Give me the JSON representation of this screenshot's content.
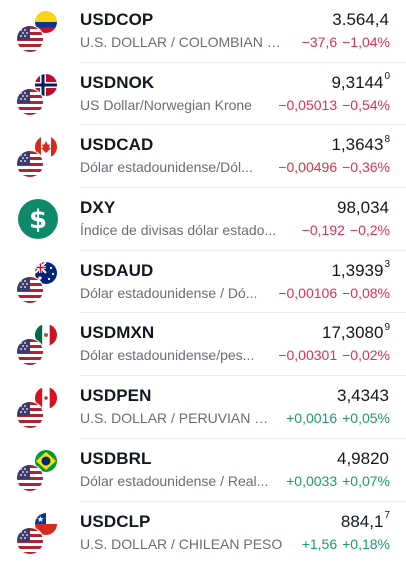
{
  "rows": [
    {
      "symbol": "USDCOP",
      "description": "U.S. DOLLAR / COLOMBIAN P...",
      "price": "3.564,4",
      "price_sup": "",
      "change": "−37,6",
      "change_pct": "−1,04%",
      "direction": "neg",
      "flag": "co"
    },
    {
      "symbol": "USDNOK",
      "description": "US Dollar/Norwegian Krone",
      "price": "9,3144",
      "price_sup": "0",
      "change": "−0,05013",
      "change_pct": "−0,54%",
      "direction": "neg",
      "flag": "no"
    },
    {
      "symbol": "USDCAD",
      "description": "Dólar estadounidense/Dól...",
      "price": "1,3643",
      "price_sup": "8",
      "change": "−0,00496",
      "change_pct": "−0,36%",
      "direction": "neg",
      "flag": "ca"
    },
    {
      "symbol": "DXY",
      "description": "Índice de divisas dólar estado...",
      "price": "98,034",
      "price_sup": "",
      "change": "−0,192",
      "change_pct": "−0,2%",
      "direction": "neg",
      "flag": "dxy"
    },
    {
      "symbol": "USDAUD",
      "description": "Dólar estadounidense / Dó...",
      "price": "1,3939",
      "price_sup": "3",
      "change": "−0,00106",
      "change_pct": "−0,08%",
      "direction": "neg",
      "flag": "au"
    },
    {
      "symbol": "USDMXN",
      "description": "Dólar estadounidense/pes...",
      "price": "17,3080",
      "price_sup": "9",
      "change": "−0,00301",
      "change_pct": "−0,02%",
      "direction": "neg",
      "flag": "mx"
    },
    {
      "symbol": "USDPEN",
      "description": "U.S. DOLLAR / PERUVIAN S...",
      "price": "3,4343",
      "price_sup": "",
      "change": "+0,0016",
      "change_pct": "+0,05%",
      "direction": "pos",
      "flag": "pe"
    },
    {
      "symbol": "USDBRL",
      "description": "Dólar estadounidense / Real...",
      "price": "4,9820",
      "price_sup": "",
      "change": "+0,0033",
      "change_pct": "+0,07%",
      "direction": "pos",
      "flag": "br"
    },
    {
      "symbol": "USDCLP",
      "description": "U.S. DOLLAR / CHILEAN PESO",
      "price": "884,1",
      "price_sup": "7",
      "change": "+1,56",
      "change_pct": "+0,18%",
      "direction": "pos",
      "flag": "cl"
    }
  ],
  "colors": {
    "negative": "#e0314b",
    "positive": "#1a9c6b",
    "dxy": "#0e8a6a"
  }
}
